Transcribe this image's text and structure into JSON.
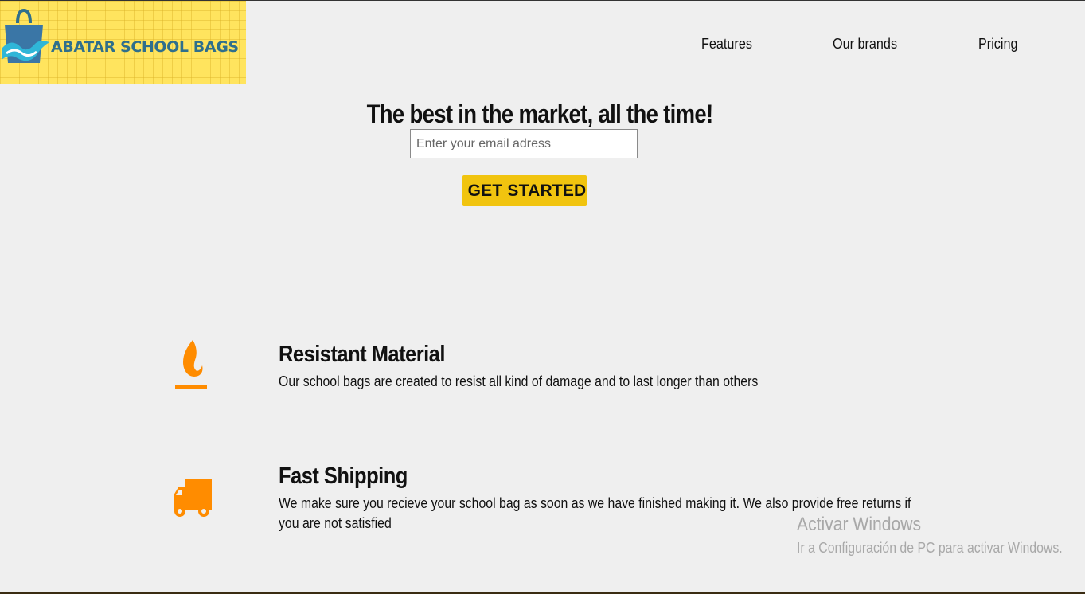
{
  "logo": {
    "text": "ABATAR SCHOOL BAGS",
    "background_color": "#ffe45e",
    "text_color": "#2f6f8c",
    "icon": "shopping-bag-wave-icon"
  },
  "nav": {
    "items": [
      {
        "label": "Features"
      },
      {
        "label": "Our brands"
      },
      {
        "label": "Pricing"
      }
    ]
  },
  "hero": {
    "title": "The best in the market, all the time!",
    "email_placeholder": "Enter your email adress",
    "cta_label": "GET STARTED",
    "cta_color": "#f1c40f"
  },
  "features": [
    {
      "icon": "fire-icon",
      "title": "Resistant Material",
      "description": "Our school bags are created to resist all kind of damage and to last longer than others"
    },
    {
      "icon": "truck-icon",
      "title": "Fast Shipping",
      "description": "We make sure you recieve your school bag as soon as we have finished making it. We also provide free returns if you are not satisfied"
    }
  ],
  "accent_icon_color": "#ff8c00",
  "watermark": {
    "title": "Activar Windows",
    "subtitle": "Ir a Configuración de PC para activar Windows."
  }
}
